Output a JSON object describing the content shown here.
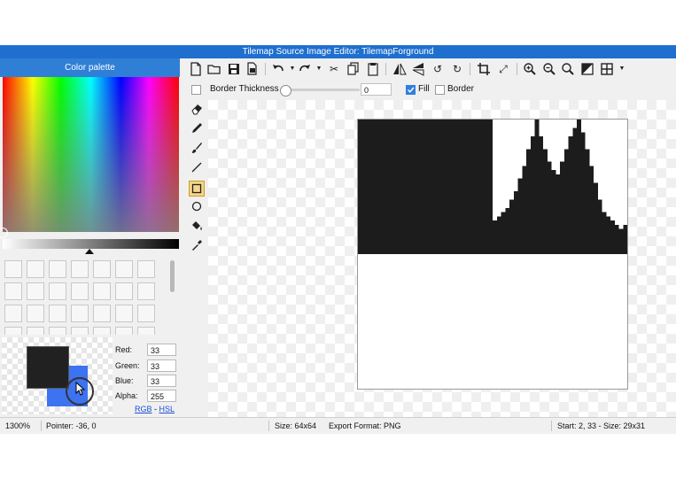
{
  "window": {
    "title": "Tilemap Source Image Editor: TilemapForground"
  },
  "palette": {
    "title": "Color palette",
    "primary_color": "#212121",
    "secondary_color": "#3d72f0",
    "fields": [
      {
        "label": "Red:",
        "value": "33"
      },
      {
        "label": "Green:",
        "value": "33"
      },
      {
        "label": "Blue:",
        "value": "33"
      },
      {
        "label": "Alpha:",
        "value": "255"
      }
    ],
    "mode_links": {
      "rgb": "RGB",
      "separator": "-",
      "hsl": "HSL"
    }
  },
  "toolbar": {
    "icons": [
      "new-file-icon",
      "open-folder-icon",
      "save-icon",
      "save-as-icon",
      "undo-icon",
      "redo-icon",
      "cut-icon",
      "copy-icon",
      "paste-icon",
      "flip-horizontal-icon",
      "flip-vertical-icon",
      "rotate-left-icon",
      "rotate-right-icon",
      "crop-icon",
      "resize-icon",
      "zoom-in-icon",
      "zoom-out-icon",
      "zoom-fit-icon",
      "invert-icon",
      "grid-icon"
    ]
  },
  "options": {
    "border_thickness_label": "Border Thickness",
    "border_thickness_value": "0",
    "fill_label": "Fill",
    "fill_checked": true,
    "border_label": "Border",
    "border_checked": false
  },
  "tools": {
    "items": [
      "eraser-icon",
      "pencil-icon",
      "brush-icon",
      "line-icon",
      "rectangle-icon",
      "ellipse-icon",
      "fill-bucket-icon",
      "eyedropper-icon"
    ],
    "active": "rectangle-icon"
  },
  "canvas": {
    "pixel_color": "#1c1c1c"
  },
  "status": {
    "zoom": "1300%",
    "pointer": "Pointer: -36, 0",
    "size": "Size: 64x64",
    "export_format": "Export Format: PNG",
    "selection": "Start: 2, 33 - Size: 29x31"
  }
}
